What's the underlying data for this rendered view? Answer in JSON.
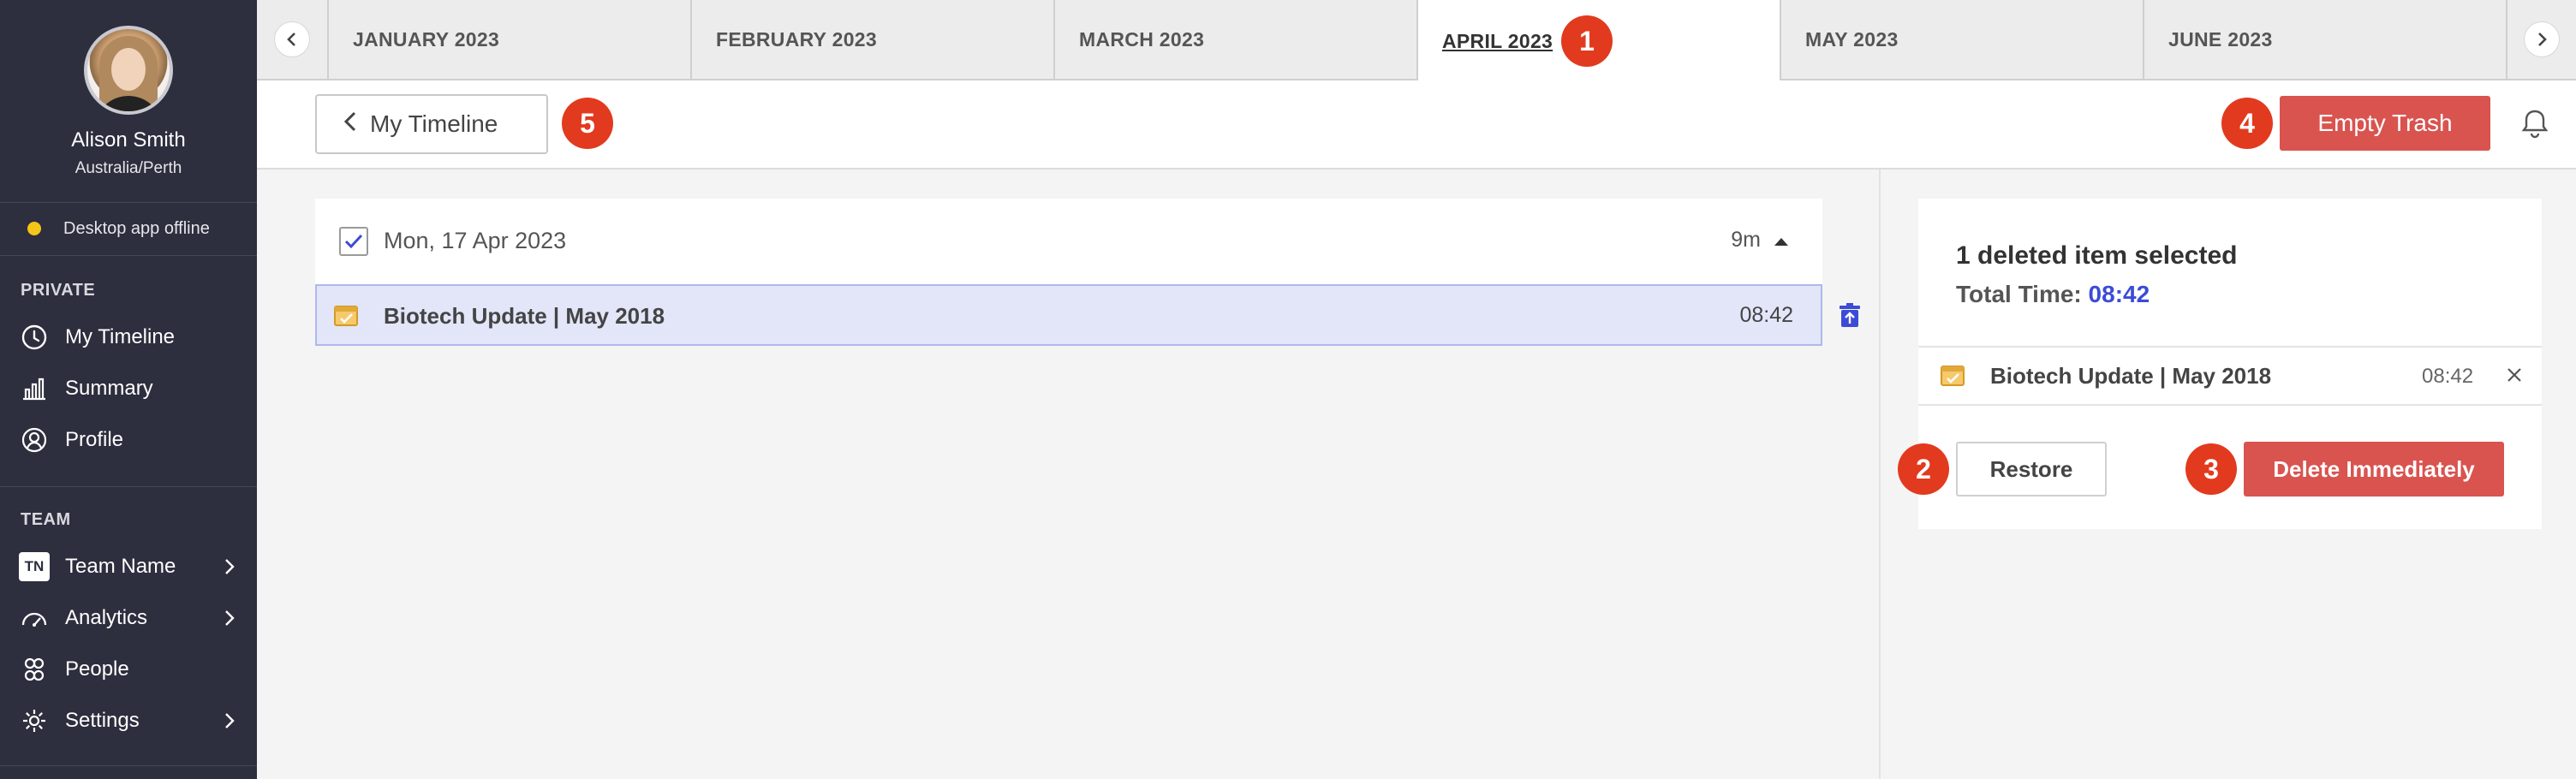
{
  "user": {
    "name": "Alison Smith",
    "timezone": "Australia/Perth"
  },
  "status": {
    "label": "Desktop app offline",
    "color": "#f5c518"
  },
  "sidebar": {
    "private_heading": "PRIVATE",
    "private_items": [
      {
        "label": "My Timeline",
        "icon": "clock-icon"
      },
      {
        "label": "Summary",
        "icon": "bar-chart-icon"
      },
      {
        "label": "Profile",
        "icon": "user-icon"
      }
    ],
    "team_heading": "TEAM",
    "team_items": [
      {
        "label": "Team Name",
        "icon": "team-badge",
        "badge": "TN"
      },
      {
        "label": "Analytics",
        "icon": "gauge-icon"
      },
      {
        "label": "People",
        "icon": "people-icon"
      },
      {
        "label": "Settings",
        "icon": "gear-icon"
      }
    ]
  },
  "tabs": [
    {
      "label": "JANUARY 2023"
    },
    {
      "label": "FEBRUARY 2023"
    },
    {
      "label": "MARCH 2023"
    },
    {
      "label": "APRIL 2023",
      "active": true
    },
    {
      "label": "MAY 2023"
    },
    {
      "label": "JUNE 2023"
    }
  ],
  "toolbar": {
    "back_label": "My Timeline",
    "empty_trash_label": "Empty Trash"
  },
  "badges": {
    "b1": "1",
    "b2": "2",
    "b3": "3",
    "b4": "4",
    "b5": "5"
  },
  "day": {
    "date": "Mon, 17 Apr 2023",
    "duration": "9m",
    "entry": {
      "title": "Biotech Update | May 2018",
      "time": "08:42"
    }
  },
  "panel": {
    "selected_text": "1 deleted item selected",
    "total_label": "Total Time:",
    "total_value": "08:42",
    "item": {
      "title": "Biotech Update | May 2018",
      "time": "08:42"
    },
    "restore_label": "Restore",
    "delete_label": "Delete Immediately"
  },
  "colors": {
    "accent_red": "#d9534f",
    "badge_red": "#e23a1e",
    "sidebar_bg": "#2d2e3e",
    "selection_blue": "#3c4bd6"
  }
}
